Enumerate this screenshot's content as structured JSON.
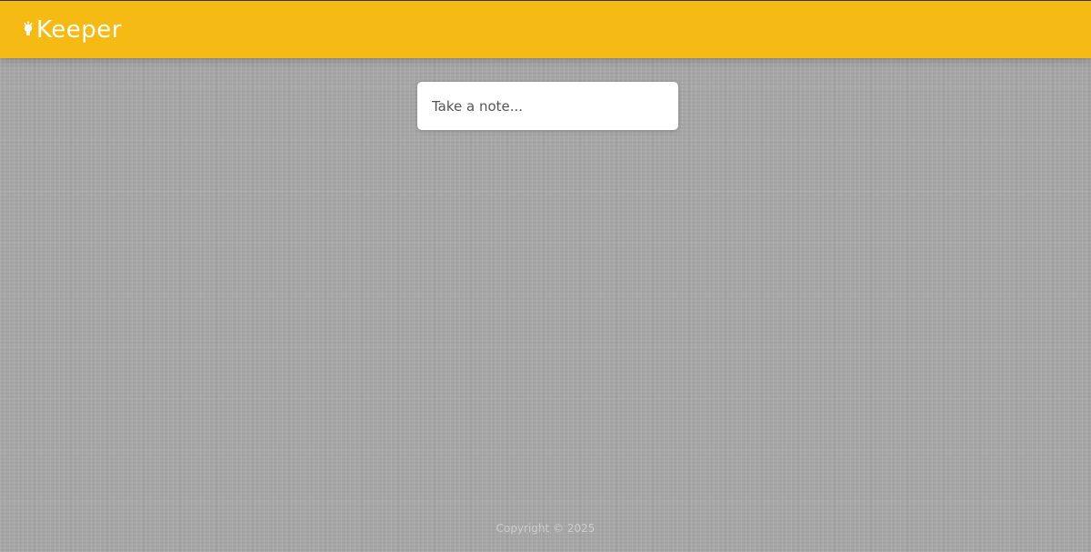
{
  "header": {
    "logo_icon": "lightbulb-icon",
    "app_name": "Keeper",
    "background_color": "#f5ba13"
  },
  "create_area": {
    "placeholder": "Take a note..."
  },
  "footer": {
    "copyright": "Copyright © 2025"
  }
}
